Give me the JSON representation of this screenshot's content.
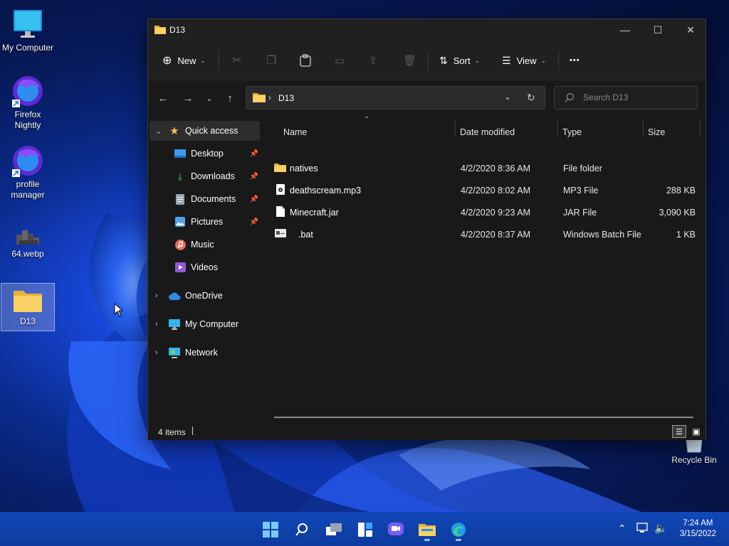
{
  "desktop": {
    "icons": [
      {
        "label": "My Computer",
        "icon": "monitor-icon"
      },
      {
        "label": "Firefox Nightly",
        "icon": "firefox-nightly-icon"
      },
      {
        "label": "profile manager",
        "icon": "firefox-nightly-icon"
      },
      {
        "label": "64.webp",
        "icon": "image-file-icon"
      },
      {
        "label": "D13",
        "icon": "folder-icon"
      },
      {
        "label": "Recycle Bin",
        "icon": "recycle-bin-icon"
      }
    ]
  },
  "window": {
    "title": "D13",
    "controls": {
      "minimize": "—",
      "maximize": "☐",
      "close": "✕"
    }
  },
  "toolbar": {
    "new_label": "New",
    "sort_label": "Sort",
    "view_label": "View",
    "more_label": "•••"
  },
  "address": {
    "crumb": "D13",
    "search_placeholder": "Search D13"
  },
  "sidebar": {
    "quick_access": "Quick access",
    "items": [
      {
        "label": "Desktop",
        "pinned": true
      },
      {
        "label": "Downloads",
        "pinned": true
      },
      {
        "label": "Documents",
        "pinned": true
      },
      {
        "label": "Pictures",
        "pinned": true
      },
      {
        "label": "Music",
        "pinned": false
      },
      {
        "label": "Videos",
        "pinned": false
      }
    ],
    "onedrive": "OneDrive",
    "my_computer": "My Computer",
    "network": "Network"
  },
  "columns": {
    "name": "Name",
    "date": "Date modified",
    "type": "Type",
    "size": "Size"
  },
  "files": [
    {
      "name": "natives",
      "date": "4/2/2020 8:36 AM",
      "type": "File folder",
      "size": "",
      "icon": "folder-icon"
    },
    {
      "name": "deathscream.mp3",
      "date": "4/2/2020 8:02 AM",
      "type": "MP3 File",
      "size": "288 KB",
      "icon": "audio-file-icon"
    },
    {
      "name": "Minecraft.jar",
      "date": "4/2/2020 9:23 AM",
      "type": "JAR File",
      "size": "3,090 KB",
      "icon": "blank-file-icon"
    },
    {
      "name": ".bat",
      "date": "4/2/2020 8:37 AM",
      "type": "Windows Batch File",
      "size": "1 KB",
      "icon": "batch-file-icon"
    }
  ],
  "status": {
    "count": "4 items"
  },
  "taskbar": {
    "time": "7:24 AM",
    "date": "3/15/2022"
  },
  "colors": {
    "accent": "#0067c0",
    "folder_yellow": "#f4c542",
    "window_bg": "#191919"
  }
}
